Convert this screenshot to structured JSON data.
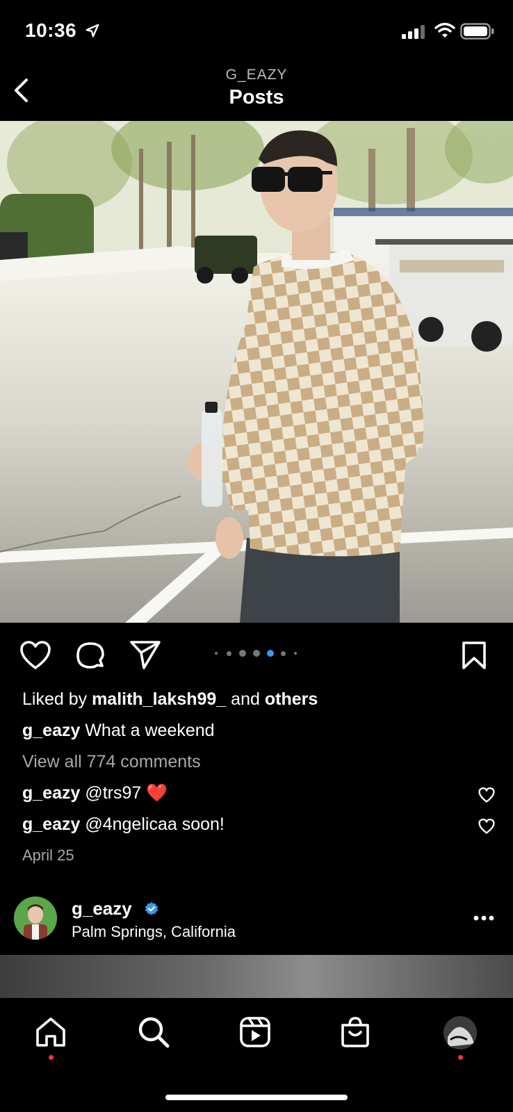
{
  "status_bar": {
    "time": "10:36"
  },
  "header": {
    "username": "G_EAZY",
    "title": "Posts",
    "back_icon": "chevron-left-icon"
  },
  "post": {
    "carousel": {
      "count": 7,
      "active_index": 4,
      "accent": "#3897f0"
    },
    "liked_by": {
      "prefix": "Liked by ",
      "user": "malith_laksh99_",
      "middle": " and ",
      "others": "others"
    },
    "caption": {
      "user": "g_eazy",
      "text": " What a weekend"
    },
    "view_comments": "View all 774 comments",
    "comments": [
      {
        "user": "g_eazy",
        "text": " @trs97 ",
        "emoji": "❤️"
      },
      {
        "user": "g_eazy",
        "text": " @4ngelicaa soon!"
      }
    ],
    "date": "April 25"
  },
  "next_post": {
    "username": "g_eazy",
    "location": "Palm Springs, California",
    "verified_color": "#3897f0"
  },
  "tab_bar": {
    "items": [
      "home-icon",
      "search-icon",
      "reels-icon",
      "shop-icon",
      "profile-avatar"
    ],
    "notification_color": "#ff3040"
  }
}
